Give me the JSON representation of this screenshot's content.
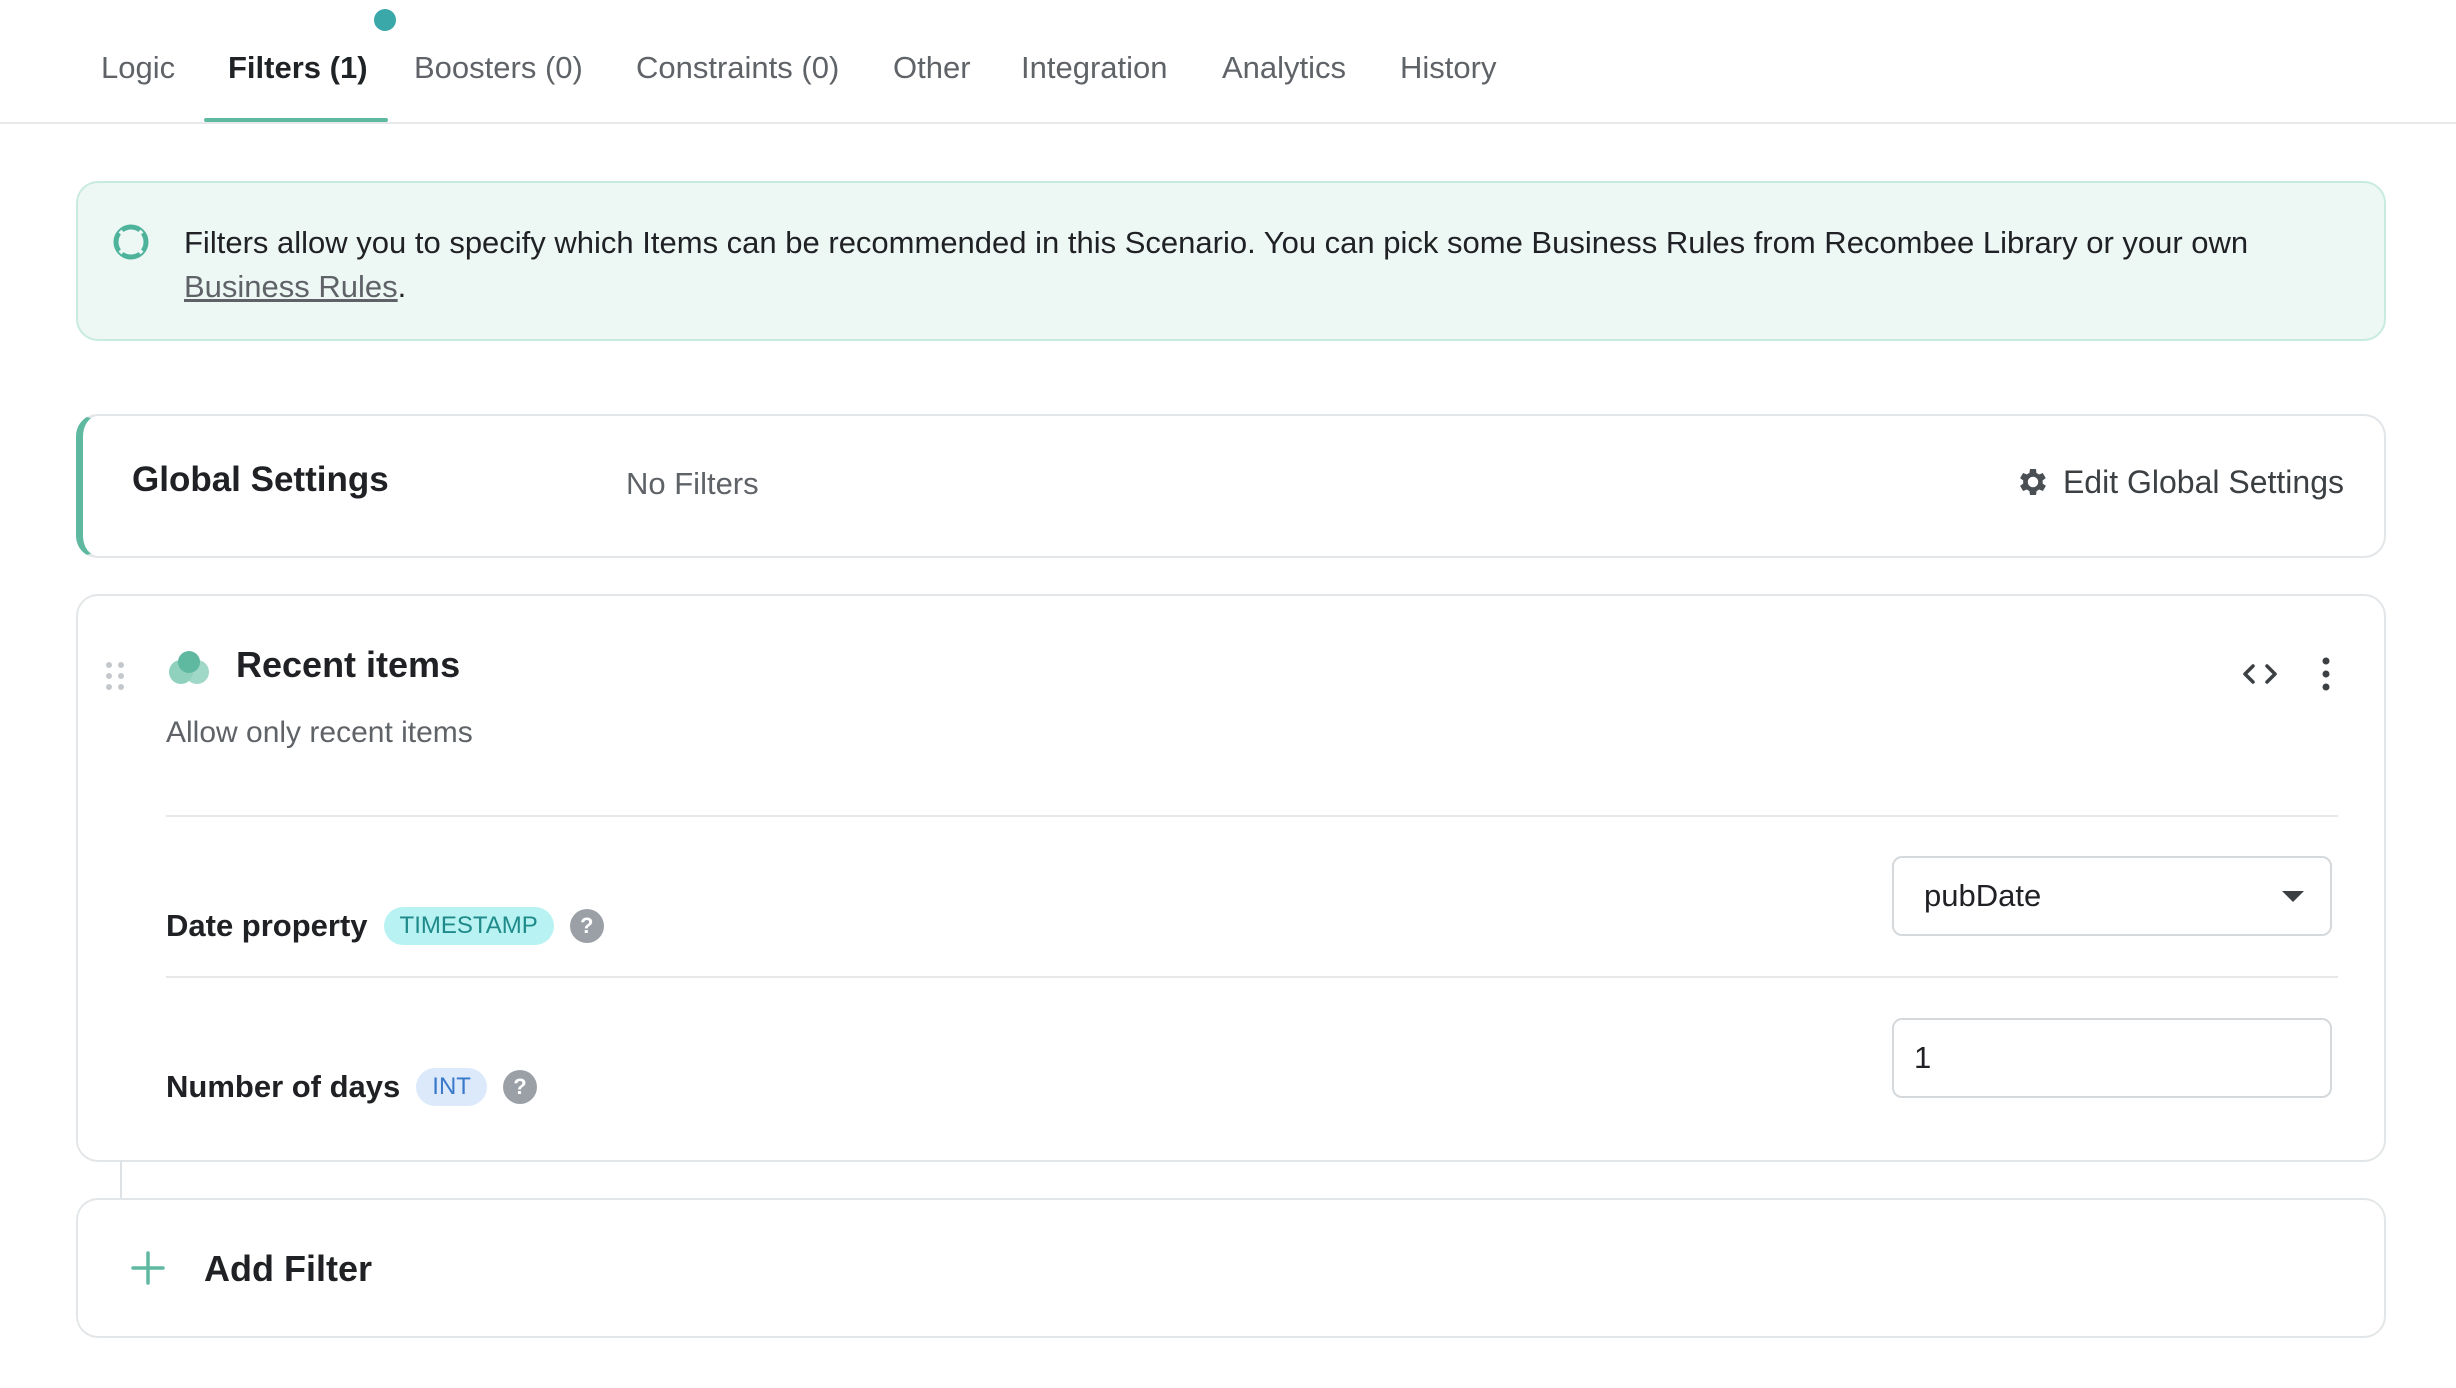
{
  "tabs": [
    {
      "label": "Logic"
    },
    {
      "label": "Filters (1)"
    },
    {
      "label": "Boosters (0)"
    },
    {
      "label": "Constraints (0)"
    },
    {
      "label": "Other"
    },
    {
      "label": "Integration"
    },
    {
      "label": "Analytics"
    },
    {
      "label": "History"
    }
  ],
  "active_tab": "Filters (1)",
  "banner": {
    "text": "Filters allow you to specify which Items can be recommended in this Scenario. You can pick some Business Rules from Recombee Library or your own ",
    "link": "Business Rules",
    "suffix": ".",
    "icon": "lifebuoy-icon"
  },
  "global_settings": {
    "title": "Global Settings",
    "status": "No Filters",
    "edit_label": "Edit Global Settings",
    "edit_icon": "gear-icon"
  },
  "filter": {
    "title": "Recent items",
    "description": "Allow only recent items",
    "params": [
      {
        "label": "Date property",
        "type": "TIMESTAMP",
        "value": "pubDate",
        "control": "select"
      },
      {
        "label": "Number of days",
        "type": "INT",
        "value": "1",
        "control": "input"
      }
    ]
  },
  "add_filter": {
    "label": "Add Filter"
  },
  "colors": {
    "accent": "#5fb8a0",
    "banner_bg": "#edf7f4",
    "timestamp_badge": "#b8f2f2",
    "int_badge": "#dbe9fb"
  }
}
